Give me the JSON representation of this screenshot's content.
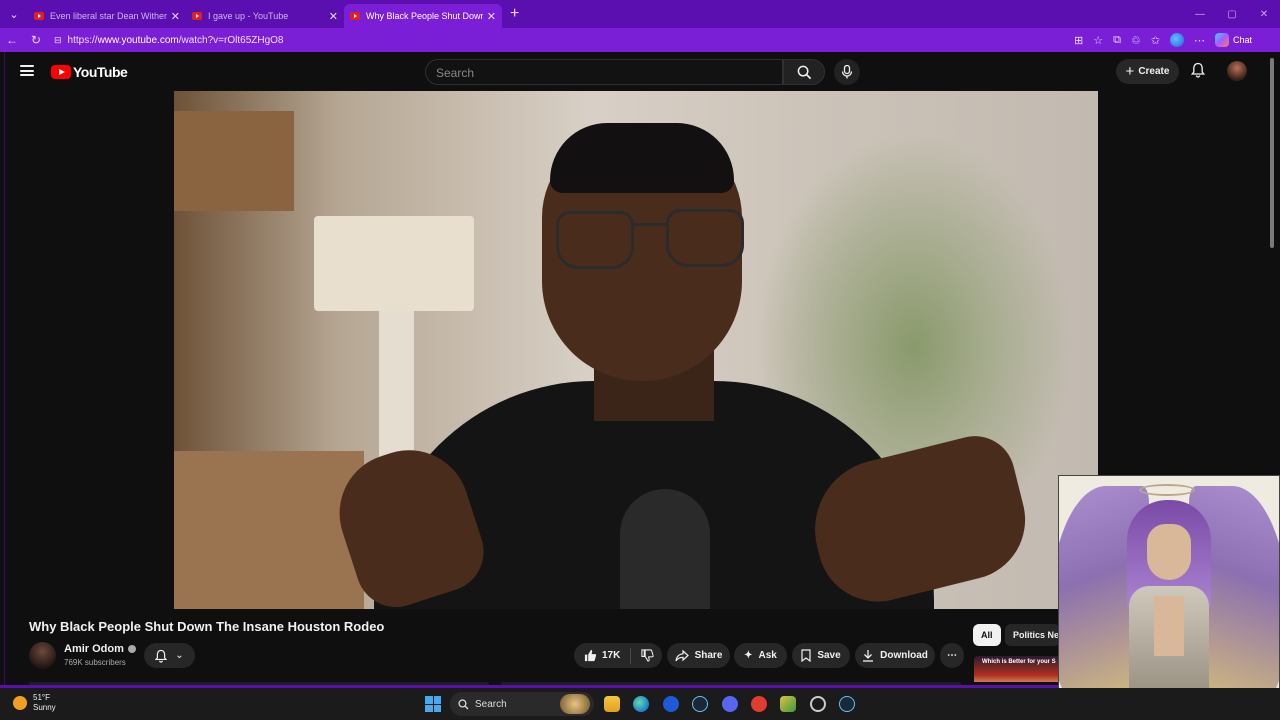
{
  "browser": {
    "tabs": [
      {
        "title": "Even liberal star Dean Withers th",
        "active": false
      },
      {
        "title": "I gave up - YouTube",
        "active": false
      },
      {
        "title": "Why Black People Shut Down The",
        "active": true
      }
    ],
    "url_prefix": "https://",
    "url_host": "www.youtube.com",
    "url_path": "/watch?v=rOlt65ZHgO8",
    "chat_label": "Chat"
  },
  "youtube": {
    "logo_text": "YouTube",
    "search_placeholder": "Search",
    "create_label": "Create"
  },
  "video": {
    "title": "Why Black People Shut Down The Insane Houston Rodeo",
    "channel_name": "Amir Odom",
    "subscribers": "769K subscribers",
    "like_count": "17K",
    "actions": {
      "share": "Share",
      "ask": "Ask",
      "save": "Save",
      "download": "Download"
    }
  },
  "sidebar": {
    "chips": [
      "All",
      "Politics Ne"
    ],
    "suggestion_thumb_text": "Which is Better for your S"
  },
  "taskbar": {
    "temperature": "51°F",
    "condition": "Sunny",
    "search_label": "Search"
  },
  "colors": {
    "browser_frame": "#5b0fb0",
    "address_bar": "#7a1fd6",
    "youtube_bg": "#0f0f0f",
    "youtube_red": "#ff0000"
  }
}
